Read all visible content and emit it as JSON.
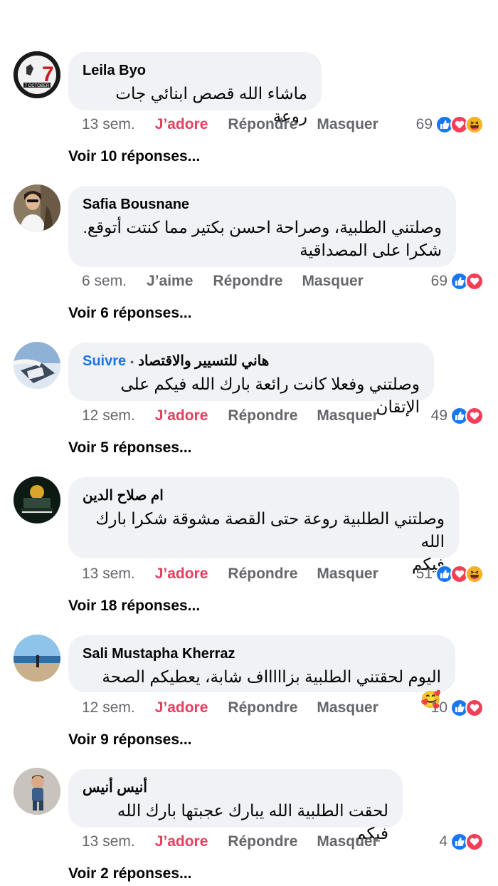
{
  "comments": [
    {
      "author": "Leila Byo",
      "text_lines": [
        "ماشاء الله قصص ابنائي جات روعة"
      ],
      "time": "13 sem.",
      "reaction_label": "J’adore",
      "reaction_type": "adore",
      "reply_label": "Répondre",
      "hide_label": "Masquer",
      "count": "69",
      "emojis": [
        "like",
        "love",
        "haha"
      ],
      "replies_label": "Voir 10 réponses...",
      "avatar_text": "7 OCTOBER"
    },
    {
      "author": "Safia Bousnane",
      "text_lines": [
        "وصلتني الطلبية، وصراحة احسن بكتير مما كنتت أتوقع.",
        "شكرا على المصداقية"
      ],
      "time": "6 sem.",
      "reaction_label": "J’aime",
      "reaction_type": "aime",
      "reply_label": "Répondre",
      "hide_label": "Masquer",
      "count": "69",
      "emojis": [
        "like",
        "love"
      ],
      "replies_label": "Voir 6 réponses..."
    },
    {
      "author": "هاني للتسيير والاقتصاد",
      "follow_label": "Suivre",
      "text_lines": [
        "وصلتني وفعلا كانت رائعة بارك الله فيكم على الإتقان"
      ],
      "time": "12 sem.",
      "reaction_label": "J’adore",
      "reaction_type": "adore",
      "reply_label": "Répondre",
      "hide_label": "Masquer",
      "count": "49",
      "emojis": [
        "like",
        "love"
      ],
      "replies_label": "Voir 5 réponses..."
    },
    {
      "author": "ام صلاح الدين",
      "text_lines": [
        "وصلتني الطلبية روعة حتى القصة مشوقة شكرا بارك الله",
        "فيكم"
      ],
      "time": "13 sem.",
      "reaction_label": "J’adore",
      "reaction_type": "adore",
      "reply_label": "Répondre",
      "hide_label": "Masquer",
      "count": "51",
      "emojis": [
        "like",
        "love",
        "haha"
      ],
      "replies_label": "Voir 18 réponses..."
    },
    {
      "author": "Sali Mustapha Kherraz",
      "text_lines": [
        "اليوم لحقتني الطلبية بزاااااف شابة، يعطيكم الصحة 🥰"
      ],
      "time": "12 sem.",
      "reaction_label": "J’adore",
      "reaction_type": "adore",
      "reply_label": "Répondre",
      "hide_label": "Masquer",
      "count": "10",
      "emojis": [
        "like",
        "love"
      ],
      "replies_label": "Voir 9 réponses..."
    },
    {
      "author": "أنيس أنيس",
      "text_lines": [
        "لحقت الطلبية الله يبارك عجبتها بارك الله فيكم"
      ],
      "time": "13 sem.",
      "reaction_label": "J’adore",
      "reaction_type": "adore",
      "reply_label": "Répondre",
      "hide_label": "Masquer",
      "count": "4",
      "emojis": [
        "like",
        "love"
      ],
      "replies_label": "Voir 2 réponses..."
    }
  ],
  "colors": {
    "adore": "#e4405f",
    "follow": "#1b74e4",
    "like": "#1877f2",
    "love": "#f33e58",
    "haha": "#f7b125",
    "bubble": "#f0f2f5",
    "muted": "#65676b"
  }
}
